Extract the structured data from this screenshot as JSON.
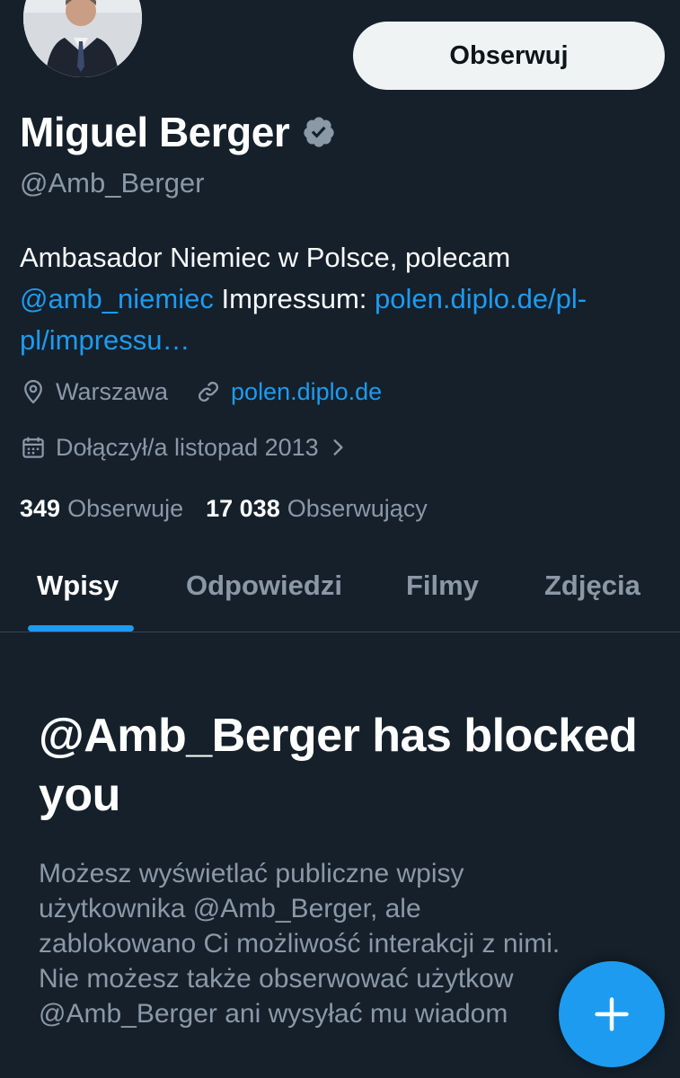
{
  "profile": {
    "display_name": "Miguel Berger",
    "handle": "@Amb_Berger",
    "verified_icon": "verified-badge-icon",
    "follow_button": "Obserwuj",
    "bio": {
      "text1": "Ambasador Niemiec w Polsce, polecam ",
      "mention": "@amb_niemiec",
      "text2": " Impressum: ",
      "url": "polen.diplo.de/pl-pl/impressu…"
    },
    "location": "Warszawa",
    "website": "polen.diplo.de",
    "joined": "Dołączył/a listopad 2013",
    "following_count": "349",
    "following_label": "Obserwuje",
    "followers_count": "17 038",
    "followers_label": "Obserwujący"
  },
  "tabs": [
    {
      "label": "Wpisy",
      "active": true
    },
    {
      "label": "Odpowiedzi",
      "active": false
    },
    {
      "label": "Filmy",
      "active": false
    },
    {
      "label": "Zdjęcia",
      "active": false
    }
  ],
  "blocked": {
    "title": "@Amb_Berger has blocked you",
    "description": "Możesz wyświetlać publiczne wpisy\nużytkownika @Amb_Berger, ale\nzablokowano Ci możliwość interakcji z nimi.\nNie możesz także obserwować użytkow\n@Amb_Berger ani wysyłać mu wiadom"
  },
  "fab_icon": "plus-icon",
  "colors": {
    "background": "#15202b",
    "accent": "#1d9bf0",
    "secondary_text": "#8b98a5",
    "divider": "#38444d"
  }
}
